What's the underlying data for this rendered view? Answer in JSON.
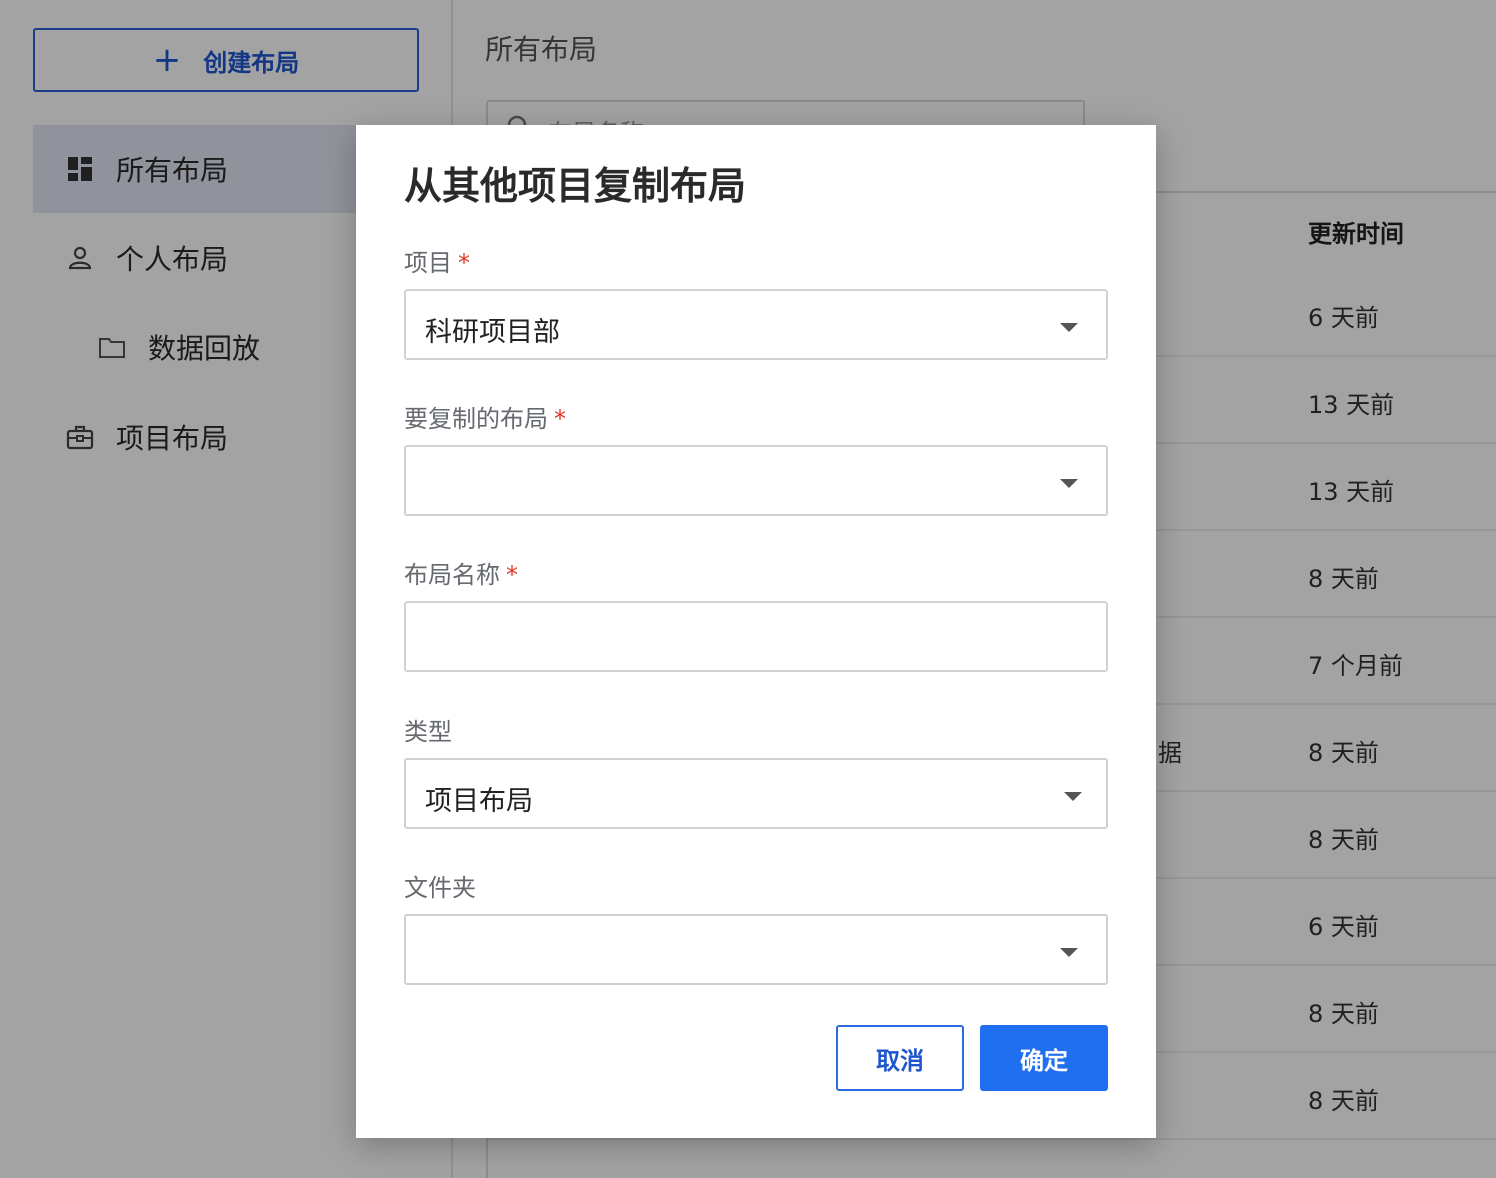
{
  "sidebar": {
    "create_button": "创建布局",
    "items": [
      {
        "label": "所有布局"
      },
      {
        "label": "个人布局"
      },
      {
        "label": "数据回放"
      },
      {
        "label": "项目布局"
      }
    ]
  },
  "main": {
    "title": "所有布局",
    "search_placeholder": "布局名称",
    "column_header": "更新时间",
    "partial_name_text": "据",
    "rows": [
      {
        "time": "6 天前"
      },
      {
        "time": "13 天前"
      },
      {
        "time": "13 天前"
      },
      {
        "time": "8 天前"
      },
      {
        "time": "7 个月前"
      },
      {
        "time": "8 天前"
      },
      {
        "time": "8 天前"
      },
      {
        "time": "6 天前"
      },
      {
        "time": "8 天前"
      },
      {
        "time": "8 天前"
      }
    ]
  },
  "dialog": {
    "title": "从其他项目复制布局",
    "fields": {
      "project": {
        "label": "项目",
        "required_mark": "*",
        "value": "科研项目部"
      },
      "layout_to_copy": {
        "label": "要复制的布局",
        "required_mark": "*",
        "value": ""
      },
      "layout_name": {
        "label": "布局名称",
        "required_mark": "*",
        "value": ""
      },
      "type": {
        "label": "类型",
        "value": "项目布局"
      },
      "folder": {
        "label": "文件夹",
        "value": ""
      }
    },
    "cancel_label": "取消",
    "ok_label": "确定"
  },
  "colors": {
    "accent": "#1f6ff0",
    "required": "#e0392b",
    "overlay": "rgba(0,0,0,0.36)"
  }
}
